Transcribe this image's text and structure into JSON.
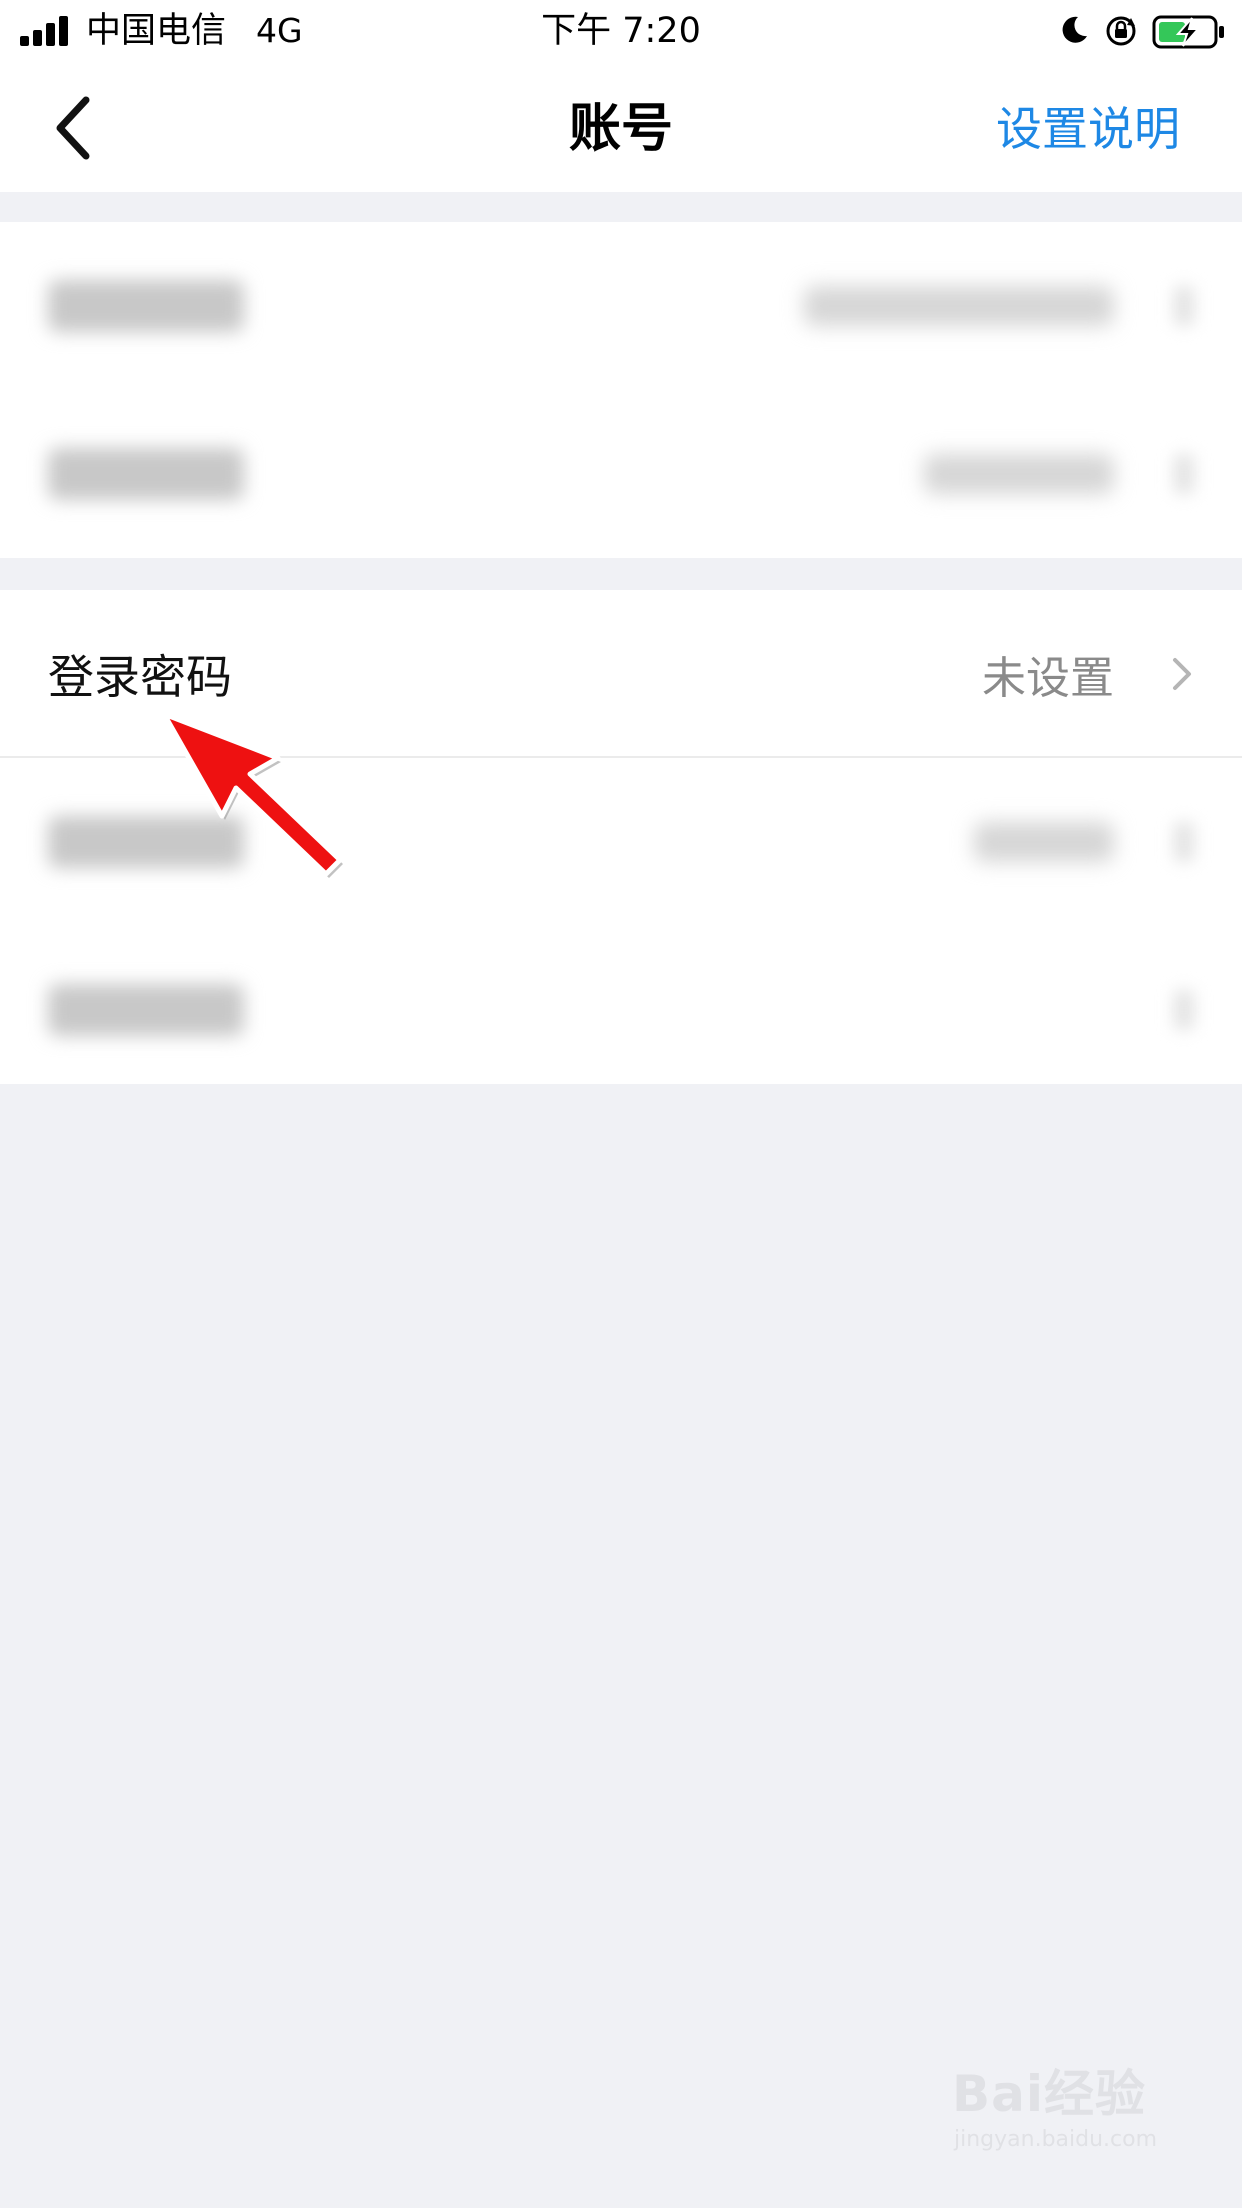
{
  "status_bar": {
    "carrier": "中国电信",
    "network": "4G",
    "time": "下午 7:20"
  },
  "nav": {
    "title": "账号",
    "action_label": "设置说明"
  },
  "list": {
    "password_row": {
      "label": "登录密码",
      "value": "未设置"
    }
  },
  "watermark": {
    "brand": "Bai经验",
    "url": "jingyan.baidu.com"
  },
  "colors": {
    "accent": "#1e88e5",
    "annotation": "#ee1111",
    "background": "#f0f1f5"
  },
  "icons": {
    "back": "chevron-left-icon",
    "chevron": "chevron-right-icon",
    "arrow": "red-arrow-icon"
  }
}
